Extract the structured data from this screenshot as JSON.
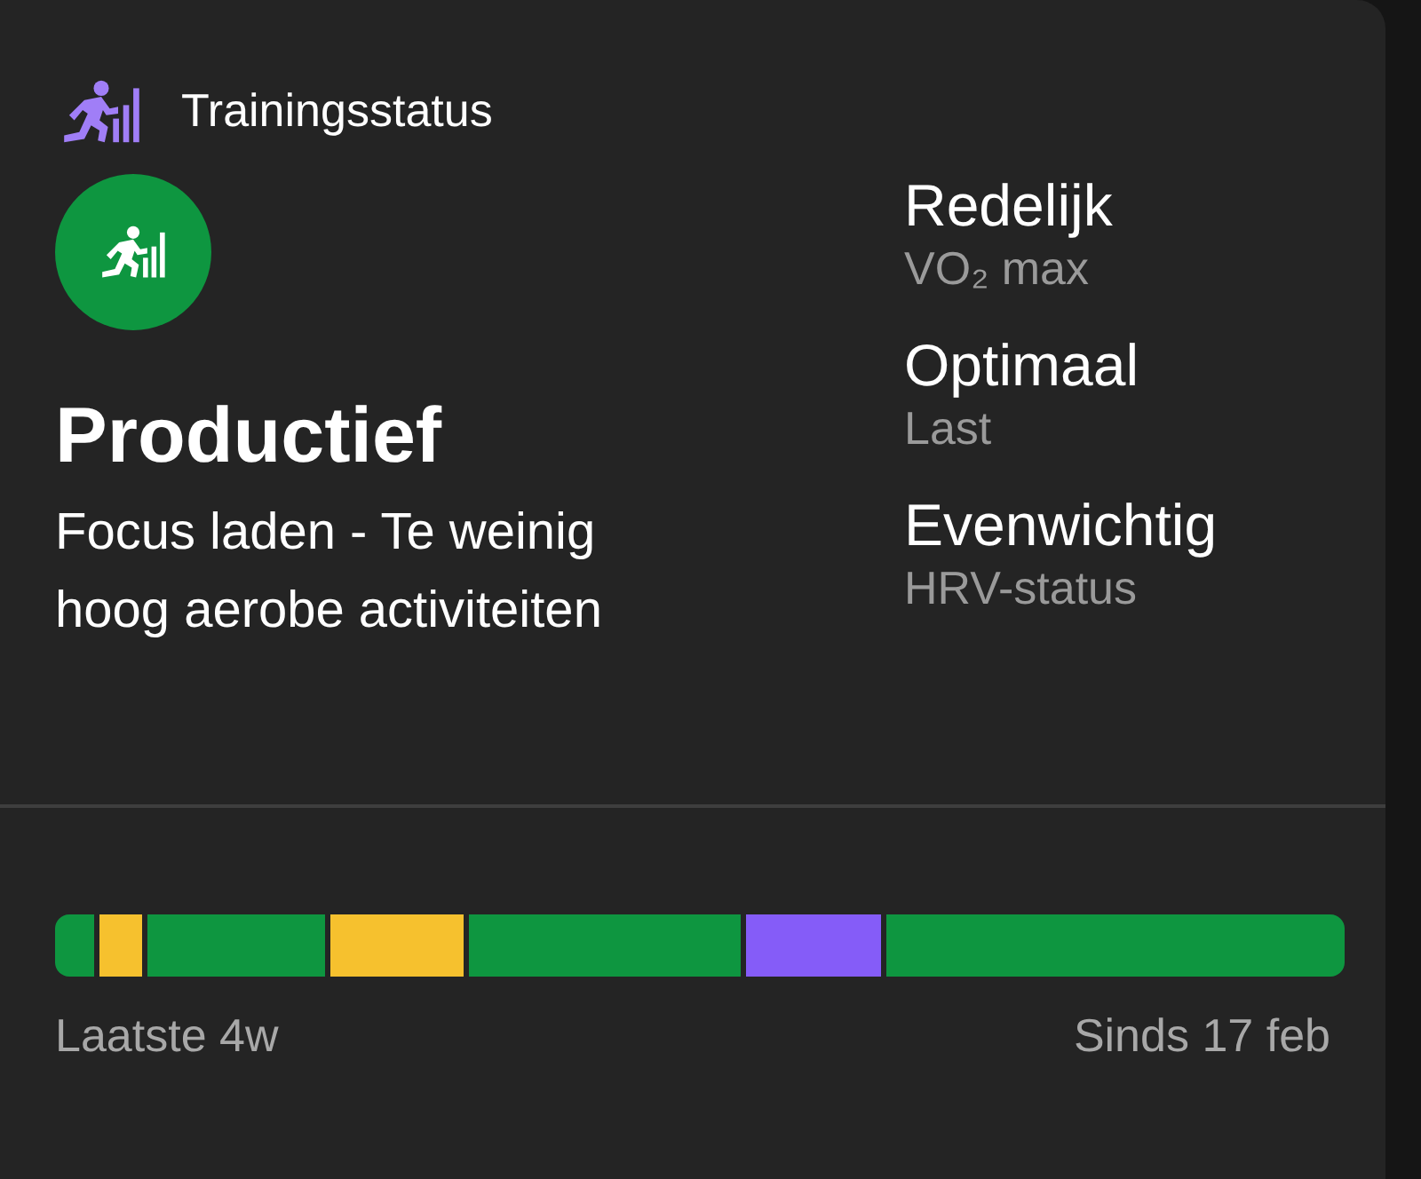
{
  "header": {
    "title": "Trainingsstatus"
  },
  "status": {
    "title": "Productief",
    "description": "Focus laden - Te weinig hoog aerobe activiteiten",
    "color": "#0e9640"
  },
  "metrics": [
    {
      "value": "Redelijk",
      "label": "VO₂ max"
    },
    {
      "value": "Optimaal",
      "label": "Last"
    },
    {
      "value": "Evenwichtig",
      "label": "HRV-status"
    }
  ],
  "timeline": {
    "segments": [
      {
        "color": "#0e9640"
      },
      {
        "color": "#f6c12e"
      },
      {
        "color": "#0e9640"
      },
      {
        "color": "#f6c12e"
      },
      {
        "color": "#0e9640"
      },
      {
        "color": "#855cf8"
      },
      {
        "color": "#0e9640"
      }
    ],
    "start_label": "Laatste 4w",
    "end_label": "Sinds 17 feb"
  }
}
